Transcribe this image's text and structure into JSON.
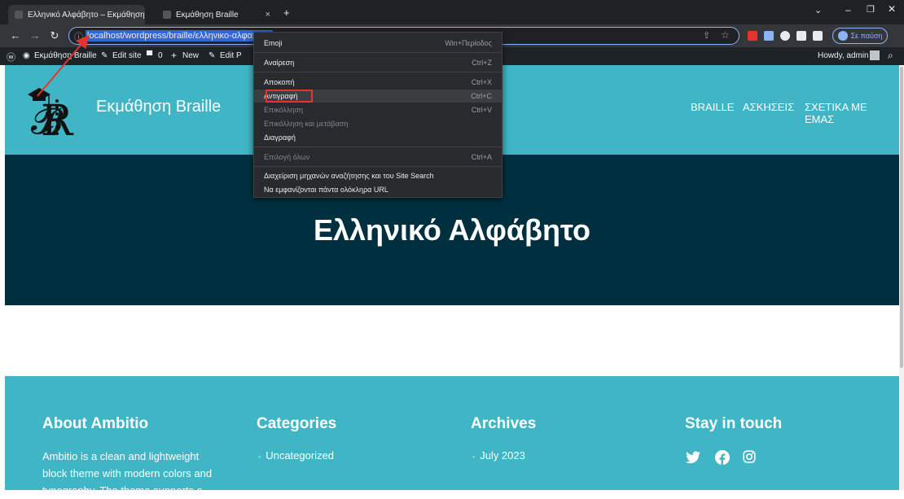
{
  "browser": {
    "tabs": [
      {
        "title": "Ελληνικό Αλφάβητο – Εκμάθηση",
        "active": true
      },
      {
        "title": "Εκμάθηση Braille",
        "active": false
      }
    ],
    "tab_close": "×",
    "new_tab": "+",
    "url": "localhost/wordpress/braille/ελληνικο-αλφαβητο",
    "pause_label": "Σε παύση"
  },
  "adminbar": {
    "site_name": "Εκμάθηση Braille",
    "edit_site": "Edit site",
    "comments_count": "0",
    "new": "New",
    "edit_page": "Edit P",
    "howdy": "Howdy, admin"
  },
  "header": {
    "site_title": "Εκμάθηση Braille",
    "nav": [
      "BRAILLE",
      "ΑΣΚΗΣΕΙΣ",
      "ΣΧΕΤΙΚΑ ΜΕ ΕΜΑΣ"
    ]
  },
  "hero": {
    "title": "Ελληνικό Αλφάβητο"
  },
  "footer": {
    "about_title": "About Ambitio",
    "about_text": "Ambitio is a clean and lightweight block theme with modern colors and typography. The theme supports a",
    "categories_title": "Categories",
    "categories_item": "Uncategorized",
    "archives_title": "Archives",
    "archives_item": "July 2023",
    "stay_title": "Stay in touch"
  },
  "context_menu": {
    "items": [
      {
        "label": "Emoji",
        "shortcut": "Win+Περίοδος",
        "disabled": false
      },
      {
        "label": "Αναίρεση",
        "shortcut": "Ctrl+Z",
        "disabled": false
      },
      {
        "label": "Αποκοπή",
        "shortcut": "Ctrl+X",
        "disabled": false
      },
      {
        "label": "Αντιγραφή",
        "shortcut": "Ctrl+C",
        "disabled": false
      },
      {
        "label": "Επικόλληση",
        "shortcut": "Ctrl+V",
        "disabled": true
      },
      {
        "label": "Επικόλληση και μετάβαση",
        "shortcut": "",
        "disabled": true
      },
      {
        "label": "Διαγραφή",
        "shortcut": "",
        "disabled": false
      },
      {
        "label": "Επιλογή όλων",
        "shortcut": "Ctrl+A",
        "disabled": true
      },
      {
        "label": "Διαχείριση μηχανών αναζήτησης και του Site Search",
        "shortcut": "",
        "disabled": false
      },
      {
        "label": "Να εμφανίζονται πάντα ολόκληρα URL",
        "shortcut": "",
        "disabled": false
      }
    ],
    "highlighted": "Αντιγραφή"
  },
  "colors": {
    "header_bg": "#3fb5c5",
    "hero_bg": "#003040",
    "annotation": "#e5342f"
  }
}
